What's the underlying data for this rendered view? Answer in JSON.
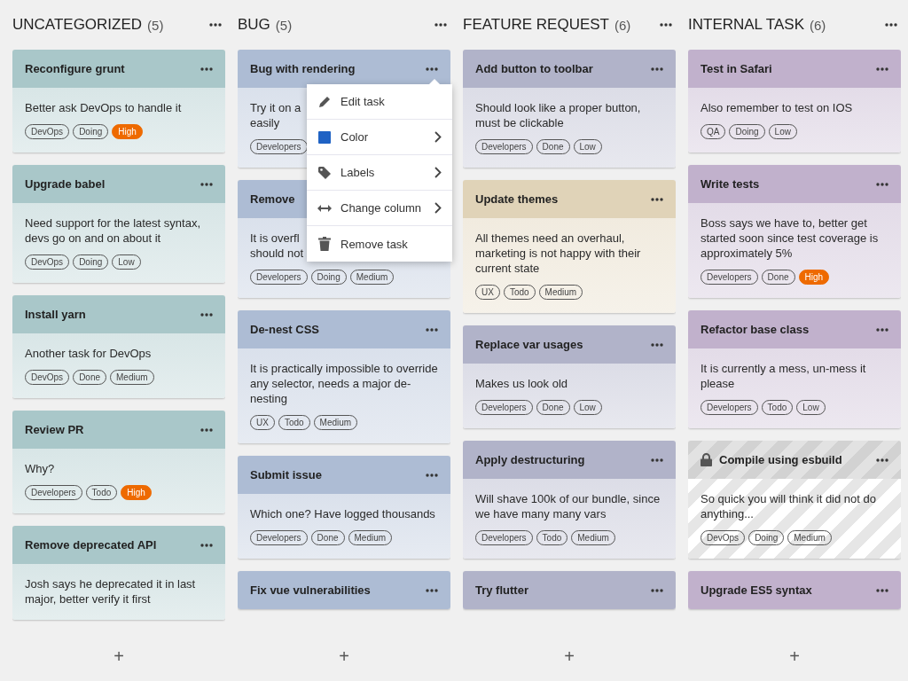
{
  "columns": [
    {
      "title": "UNCATEGORIZED",
      "count": "(5)",
      "add_label": "+",
      "cards": [
        {
          "title": "Reconfigure grunt",
          "description": "Better ask DevOps to handle it",
          "color": "#a9c7c9",
          "locked": false,
          "tags": [
            {
              "label": "DevOps",
              "highlighted": false
            },
            {
              "label": "Doing",
              "highlighted": false
            },
            {
              "label": "High",
              "highlighted": true
            }
          ]
        },
        {
          "title": "Upgrade babel",
          "description": "Need support for the latest syntax, devs go on and on about it",
          "color": "#a9c7c9",
          "locked": false,
          "tags": [
            {
              "label": "DevOps",
              "highlighted": false
            },
            {
              "label": "Doing",
              "highlighted": false
            },
            {
              "label": "Low",
              "highlighted": false
            }
          ]
        },
        {
          "title": "Install yarn",
          "description": "Another task for DevOps",
          "color": "#a9c7c9",
          "locked": false,
          "tags": [
            {
              "label": "DevOps",
              "highlighted": false
            },
            {
              "label": "Done",
              "highlighted": false
            },
            {
              "label": "Medium",
              "highlighted": false
            }
          ]
        },
        {
          "title": "Review PR",
          "description": "Why?",
          "color": "#a9c7c9",
          "locked": false,
          "tags": [
            {
              "label": "Developers",
              "highlighted": false
            },
            {
              "label": "Todo",
              "highlighted": false
            },
            {
              "label": "High",
              "highlighted": true
            }
          ]
        },
        {
          "title": "Remove deprecated API",
          "description": "Josh says he deprecated it in last major, better verify it first",
          "color": "#a9c7c9",
          "locked": false
        }
      ]
    },
    {
      "title": "BUG",
      "count": "(5)",
      "add_label": "+",
      "cards": [
        {
          "title": "Bug with rendering",
          "description": "Try it on a\neasily",
          "color": "#adbcd4",
          "locked": false,
          "tags": [
            {
              "label": "Developers",
              "highlighted": false
            }
          ]
        },
        {
          "title": "Remove",
          "description": "It is overfl\nshould not",
          "color": "#adbcd4",
          "locked": false,
          "tags": [
            {
              "label": "Developers",
              "highlighted": false
            },
            {
              "label": "Doing",
              "highlighted": false
            },
            {
              "label": "Medium",
              "highlighted": false
            }
          ]
        },
        {
          "title": "De-nest CSS",
          "description": "It is practically impossible to override any selector, needs a major de-nesting",
          "color": "#adbcd4",
          "locked": false,
          "tags": [
            {
              "label": "UX",
              "highlighted": false
            },
            {
              "label": "Todo",
              "highlighted": false
            },
            {
              "label": "Medium",
              "highlighted": false
            }
          ]
        },
        {
          "title": "Submit issue",
          "description": "Which one? Have logged thousands",
          "color": "#adbcd4",
          "locked": false,
          "tags": [
            {
              "label": "Developers",
              "highlighted": false
            },
            {
              "label": "Done",
              "highlighted": false
            },
            {
              "label": "Medium",
              "highlighted": false
            }
          ]
        },
        {
          "title": "Fix vue vulnerabilities",
          "color": "#adbcd4",
          "locked": false
        }
      ],
      "context_menu": {
        "items": [
          {
            "label": "Edit task",
            "kind": "edit",
            "submenu": false
          },
          {
            "label": "Color",
            "kind": "color",
            "submenu": true
          },
          {
            "label": "Labels",
            "kind": "labels",
            "submenu": true
          },
          {
            "label": "Change column",
            "kind": "move",
            "submenu": true
          },
          {
            "label": "Remove task",
            "kind": "remove",
            "submenu": false
          }
        ]
      }
    },
    {
      "title": "FEATURE REQUEST",
      "count": "(6)",
      "add_label": "+",
      "cards": [
        {
          "title": "Add button to toolbar",
          "description": "Should look like a proper button, must be clickable",
          "color": "#b1b3c9",
          "locked": false,
          "tags": [
            {
              "label": "Developers",
              "highlighted": false
            },
            {
              "label": "Done",
              "highlighted": false
            },
            {
              "label": "Low",
              "highlighted": false
            }
          ]
        },
        {
          "title": "Update themes",
          "description": "All themes need an overhaul, marketing is not happy with their current state",
          "color": "#e0d3b8",
          "locked": false,
          "tags": [
            {
              "label": "UX",
              "highlighted": false
            },
            {
              "label": "Todo",
              "highlighted": false
            },
            {
              "label": "Medium",
              "highlighted": false
            }
          ]
        },
        {
          "title": "Replace var usages",
          "description": "Makes us look old",
          "color": "#b1b3c9",
          "locked": false,
          "tags": [
            {
              "label": "Developers",
              "highlighted": false
            },
            {
              "label": "Done",
              "highlighted": false
            },
            {
              "label": "Low",
              "highlighted": false
            }
          ]
        },
        {
          "title": "Apply destructuring",
          "description": "Will shave 100k of our bundle, since we have many many vars",
          "color": "#b1b3c9",
          "locked": false,
          "tags": [
            {
              "label": "Developers",
              "highlighted": false
            },
            {
              "label": "Todo",
              "highlighted": false
            },
            {
              "label": "Medium",
              "highlighted": false
            }
          ]
        },
        {
          "title": "Try flutter",
          "color": "#b1b3c9",
          "locked": false
        }
      ]
    },
    {
      "title": "INTERNAL TASK",
      "count": "(6)",
      "add_label": "+",
      "cards": [
        {
          "title": "Test in Safari",
          "description": "Also remember to test on IOS",
          "color": "#c1b1cc",
          "locked": false,
          "tags": [
            {
              "label": "QA",
              "highlighted": false
            },
            {
              "label": "Doing",
              "highlighted": false
            },
            {
              "label": "Low",
              "highlighted": false
            }
          ]
        },
        {
          "title": "Write tests",
          "description": "Boss says we have to, better get started soon since test coverage is approximately 5%",
          "color": "#c1b1cc",
          "locked": false,
          "tags": [
            {
              "label": "Developers",
              "highlighted": false
            },
            {
              "label": "Done",
              "highlighted": false
            },
            {
              "label": "High",
              "highlighted": true
            }
          ]
        },
        {
          "title": "Refactor base class",
          "description": "It is currently a mess, un-mess it please",
          "color": "#c1b1cc",
          "locked": false,
          "tags": [
            {
              "label": "Developers",
              "highlighted": false
            },
            {
              "label": "Todo",
              "highlighted": false
            },
            {
              "label": "Low",
              "highlighted": false
            }
          ]
        },
        {
          "title": "Compile using esbuild",
          "description": "So quick you will think it did not do anything...",
          "color": "#d6d6d6",
          "locked": true,
          "tags": [
            {
              "label": "DevOps",
              "highlighted": false
            },
            {
              "label": "Doing",
              "highlighted": false
            },
            {
              "label": "Medium",
              "highlighted": false
            }
          ]
        },
        {
          "title": "Upgrade ES5 syntax",
          "color": "#c1b1cc",
          "locked": false
        }
      ]
    }
  ]
}
